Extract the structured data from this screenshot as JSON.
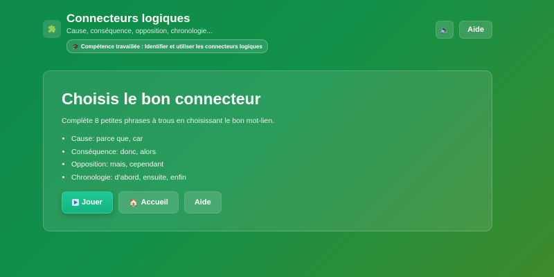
{
  "header": {
    "title": "Connecteurs logiques",
    "subtitle": "Cause, conséquence, opposition, chronologie...",
    "skill_badge": "Compétence travaillée : Identifier et utiliser les connecteurs logiques",
    "app_icon": "puzzle-icon",
    "sound_icon": "speaker-muted-icon",
    "help_label": "Aide"
  },
  "card": {
    "title": "Choisis le bon connecteur",
    "description": "Complète 8 petites phrases à trous en choisissant le bon mot-lien.",
    "items": [
      "Cause: parce que, car",
      "Conséquence: donc, alors",
      "Opposition: mais, cependant",
      "Chronologie: d’abord, ensuite, enfin"
    ],
    "buttons": {
      "play": "Jouer",
      "home": "Accueil",
      "help": "Aide"
    }
  },
  "colors": {
    "background_start": "#0d8a4a",
    "background_end": "#3d8a2a",
    "primary_button": "#1fc896"
  }
}
